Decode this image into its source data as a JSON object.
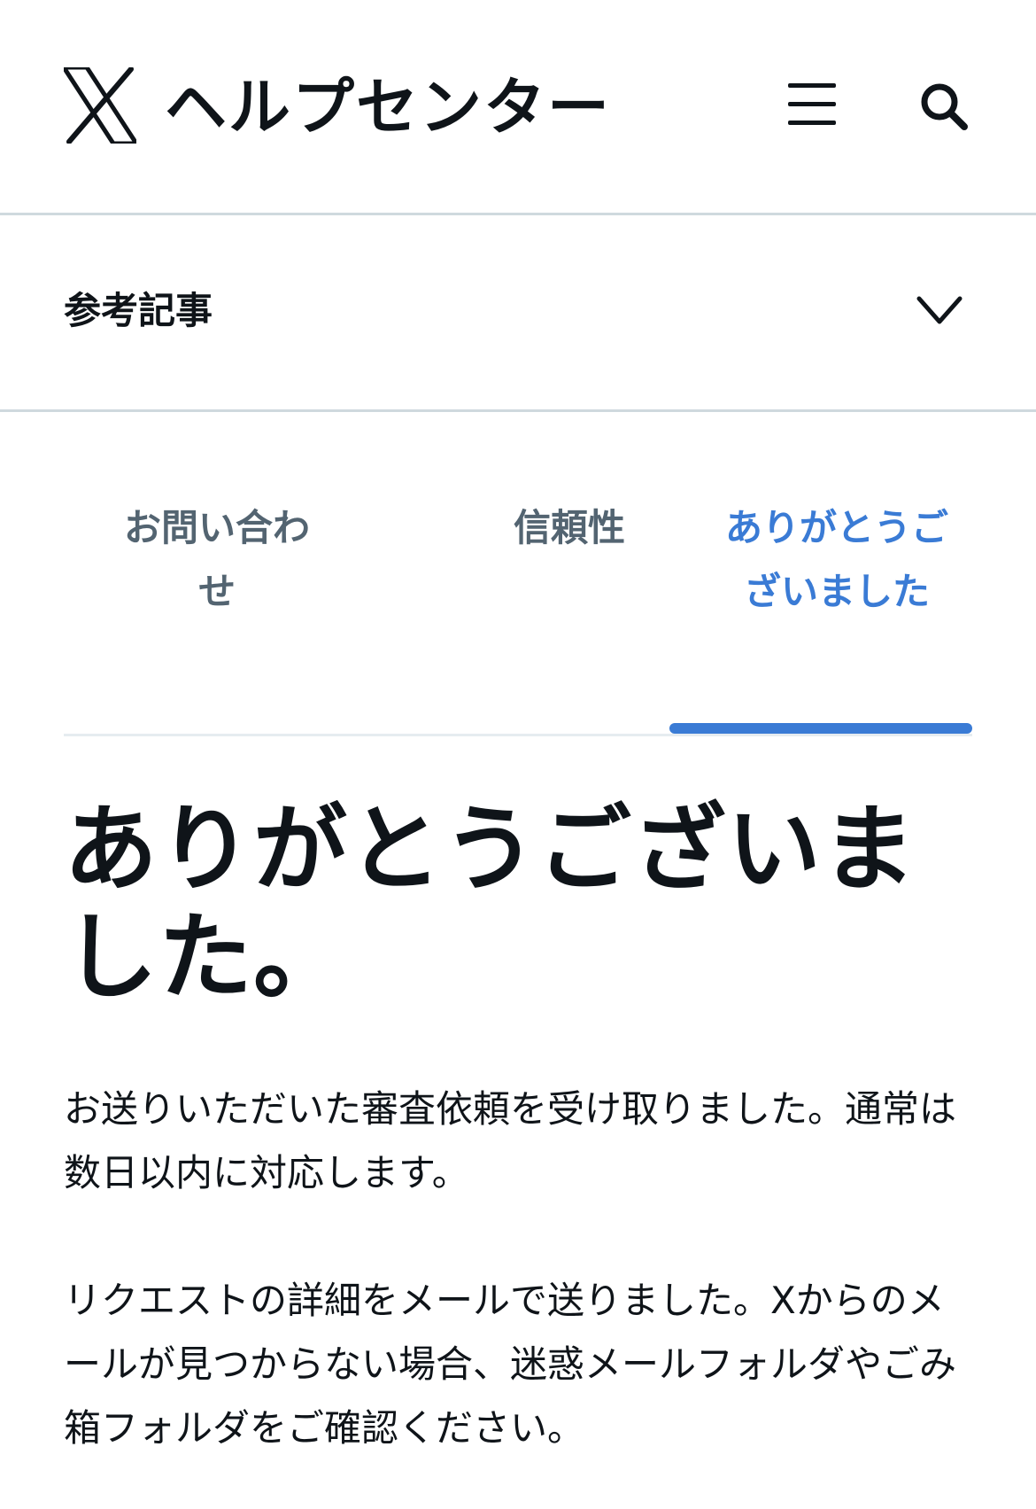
{
  "header": {
    "title": "ヘルプセンター",
    "logo_icon": "x-logo-icon",
    "menu_icon": "hamburger-menu-icon",
    "search_icon": "search-icon"
  },
  "related": {
    "label": "参考記事",
    "chevron_icon": "chevron-down-icon"
  },
  "tabs": [
    {
      "label": "お問い合わせ",
      "active": false
    },
    {
      "label": "信頼性",
      "active": false
    },
    {
      "label": "ありがとうございました",
      "active": true
    }
  ],
  "main": {
    "title": "ありがとうございました。",
    "paragraphs": [
      "お送りいただいた審査依頼を受け取りました。通常は数日以内に対応します。",
      "リクエストの詳細をメールで送りました。Xからのメールが見つからない場合、迷惑メールフォルダやごみ箱フォルダをご確認ください。"
    ]
  },
  "colors": {
    "text": "#0f1419",
    "muted": "#536471",
    "accent": "#3a7bd5",
    "divider": "#cfd9de"
  }
}
